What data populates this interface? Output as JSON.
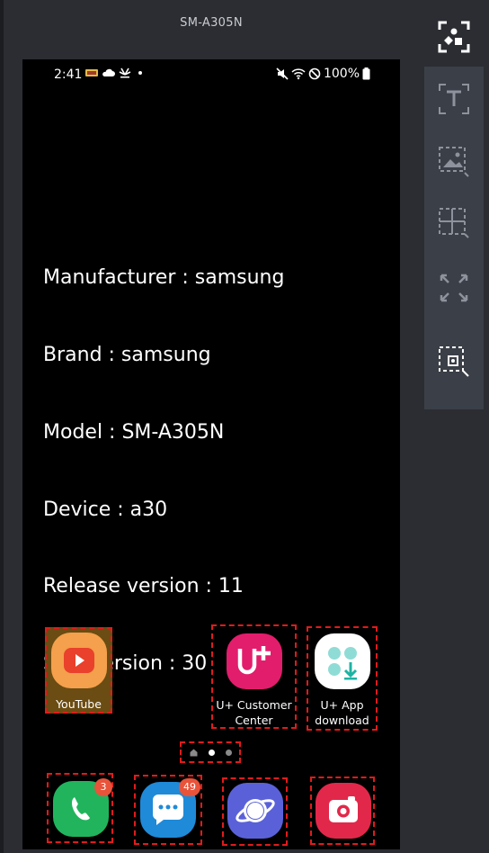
{
  "window": {
    "device_title": "SM-A305N"
  },
  "status_bar": {
    "time": "2:41",
    "battery": "100%",
    "left_icons": [
      "notification-icon",
      "cloud-icon",
      "huawei-news-icon",
      "dot-icon"
    ],
    "right_icons": [
      "mute-icon",
      "wifi-icon",
      "no-sign-icon",
      "battery-icon"
    ]
  },
  "device_info": {
    "manufacturer": "Manufacturer : samsung",
    "brand": "Brand : samsung",
    "model": "Model : SM-A305N",
    "device": "Device : a30",
    "release": "Release version : 11",
    "sdk": "SDK version : 30"
  },
  "home_apps": [
    {
      "label": "YouTube",
      "icon": "youtube-icon",
      "color": "#f4a04c",
      "highlighted": true
    },
    {
      "label": "U+ Customer Center",
      "label_line1": "U+ Customer",
      "label_line2": "Center",
      "icon": "uplus-icon",
      "color": "#e21d6c"
    },
    {
      "label": "U+ App download",
      "label_line1": "U+ App",
      "label_line2": "download",
      "icon": "app-download-icon",
      "color": "#ffffff"
    }
  ],
  "dock_apps": [
    {
      "name": "Phone",
      "icon": "phone-icon",
      "color": "#21b45d",
      "badge": "3"
    },
    {
      "name": "Messages",
      "icon": "messages-icon",
      "color": "#1f8ad8",
      "badge": "49"
    },
    {
      "name": "Internet",
      "icon": "internet-icon",
      "color": "#5a61d8",
      "badge": ""
    },
    {
      "name": "Camera",
      "icon": "camera-icon",
      "color": "#e2284a",
      "badge": ""
    }
  ],
  "page_indicator": {
    "pages": 3,
    "current": 2
  },
  "tools": [
    "text-select-icon",
    "image-select-icon",
    "grid-select-icon",
    "expand-icon",
    "element-select-icon"
  ],
  "colors": {
    "highlight_border": "#e11b1b",
    "panel_bg": "#3b3f47",
    "app_bg": "#2b2d33"
  }
}
